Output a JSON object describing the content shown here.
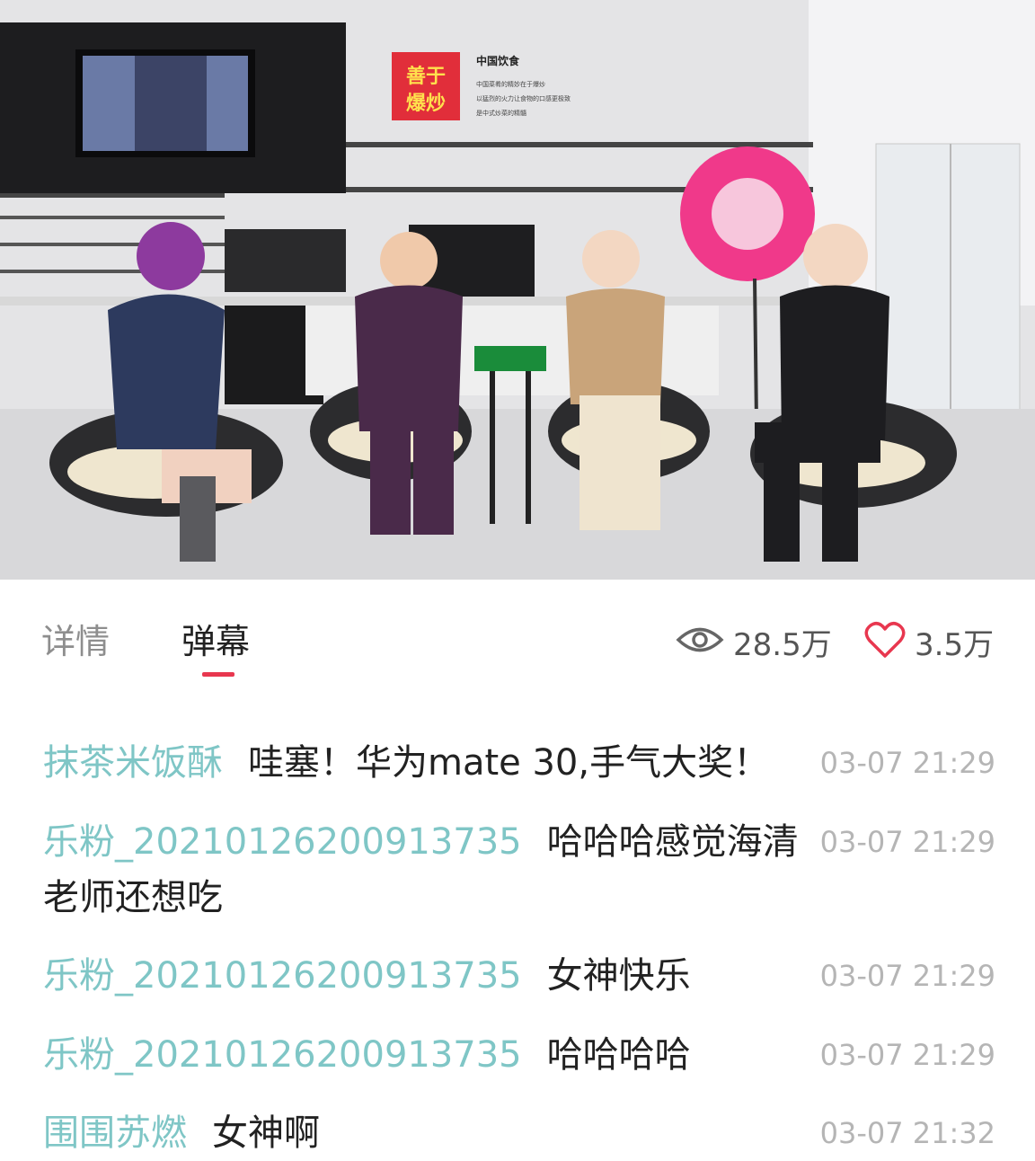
{
  "video": {
    "sign_title": "善于爆炒",
    "sign_heading": "中国饮食",
    "sign_lines": [
      "中国菜肴的精妙在于爆炒",
      "以猛烈的火力让食物的口感更极致",
      "是中式炒菜的精髓"
    ],
    "colors": {
      "wheel": "#f0398a",
      "chairs": "#2c2c2e",
      "cushion": "#efe6cf"
    }
  },
  "tabs": [
    {
      "label": "详情",
      "active": false
    },
    {
      "label": "弹幕",
      "active": true
    }
  ],
  "stats": {
    "views": "28.5万",
    "likes": "3.5万",
    "view_icon": "eye-icon",
    "like_icon": "heart-icon"
  },
  "comments": [
    {
      "user": "抹茶米饭酥",
      "text": "哇塞！华为mate 30,手气大奖！",
      "time": "03-07 21:29"
    },
    {
      "user": "乐粉_20210126200913735",
      "text": "哈哈哈感觉海清",
      "text_cont": "老师还想吃",
      "time": "03-07 21:29"
    },
    {
      "user": "乐粉_20210126200913735",
      "text": "女神快乐",
      "time": "03-07 21:29"
    },
    {
      "user": "乐粉_20210126200913735",
      "text": "哈哈哈哈",
      "time": "03-07 21:29"
    },
    {
      "user": "围围苏燃",
      "text": "女神啊",
      "time": "03-07 21:32"
    }
  ],
  "colors": {
    "accent": "#e8374f",
    "username": "#7fc6c6",
    "timestamp": "#b5b5b5"
  }
}
